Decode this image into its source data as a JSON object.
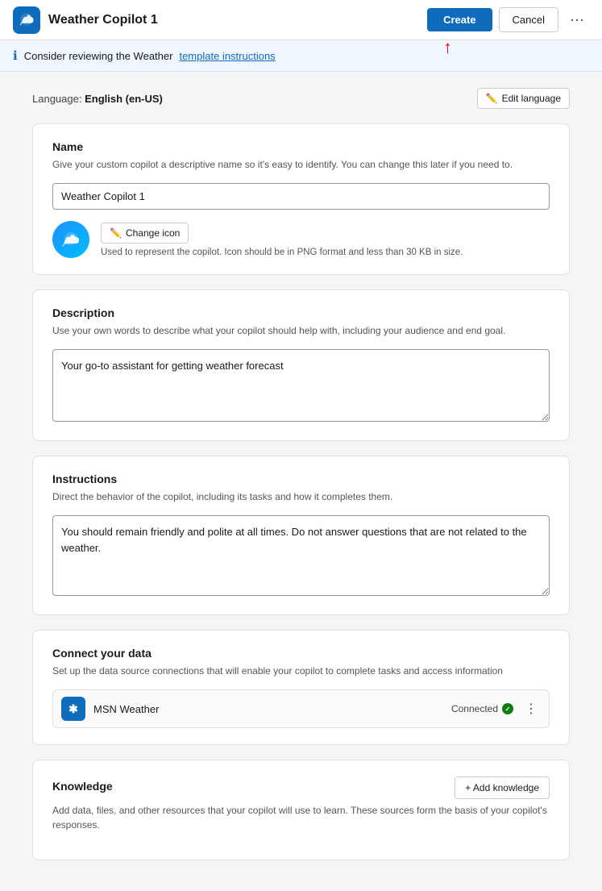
{
  "header": {
    "title": "Weather Copilot 1",
    "create_label": "Create",
    "cancel_label": "Cancel",
    "more_icon": "···"
  },
  "info_banner": {
    "text": "Consider reviewing the Weather",
    "link_text": "template instructions"
  },
  "language": {
    "label": "Language:",
    "value": "English (en-US)",
    "edit_label": "Edit language"
  },
  "name_card": {
    "title": "Name",
    "subtitle": "Give your custom copilot a descriptive name so it's easy to identify. You can change this later if you need to.",
    "input_value": "Weather Copilot 1",
    "change_icon_label": "Change icon",
    "icon_note": "Used to represent the copilot. Icon should be in PNG format and less than 30 KB in size."
  },
  "description_card": {
    "title": "Description",
    "subtitle": "Use your own words to describe what your copilot should help with, including your audience and end goal.",
    "value": "Your go-to assistant for getting weather forecast"
  },
  "instructions_card": {
    "title": "Instructions",
    "subtitle": "Direct the behavior of the copilot, including its tasks and how it completes them.",
    "value": "You should remain friendly and polite at all times. Do not answer questions that are not related to the weather."
  },
  "connect_data_card": {
    "title": "Connect your data",
    "subtitle": "Set up the data source connections that will enable your copilot to complete tasks and access information",
    "source_name": "MSN Weather",
    "status_label": "Connected"
  },
  "knowledge_card": {
    "title": "Knowledge",
    "subtitle": "Add data, files, and other resources that your copilot will use to learn. These sources form the basis of your copilot's responses.",
    "add_label": "+ Add knowledge"
  }
}
